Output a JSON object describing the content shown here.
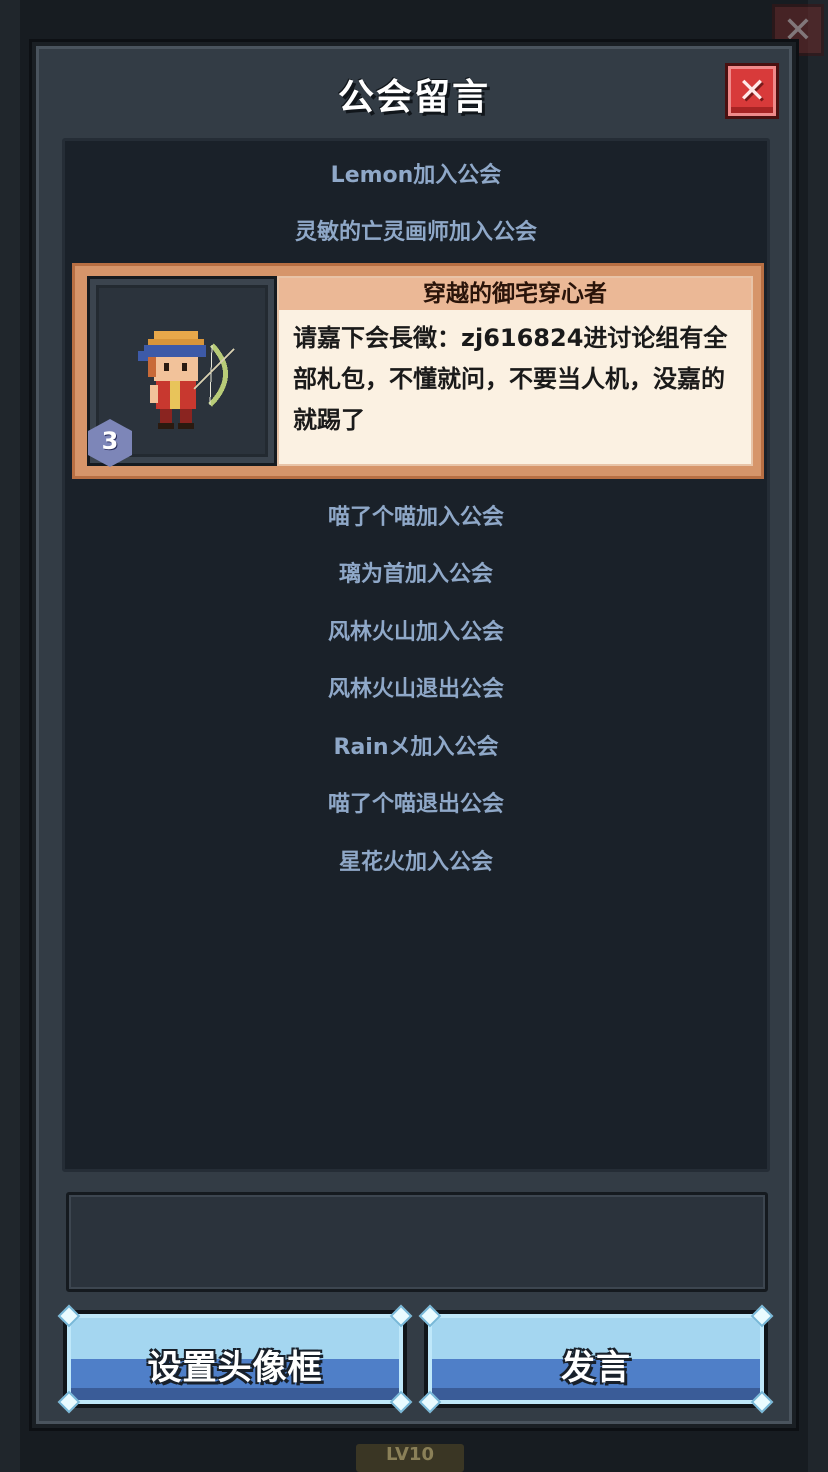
{
  "dialog": {
    "title": "公会留言",
    "close_label": "✕"
  },
  "messages": {
    "system_top": [
      "Lemon加入公会",
      "灵敏的亡灵画师加入公会"
    ],
    "chat": {
      "name": "穿越的御宅穿心者",
      "level": "3",
      "text": "请嘉下会長徵：zj616824进讨论组有全部札包，不懂就问，不要当人机，没嘉的就踢了"
    },
    "system_bottom": [
      "喵了个喵加入公会",
      "璃为首加入公会",
      "风林火山加入公会",
      "风林火山退出公会",
      "Rainメ加入公会",
      "喵了个喵退出公会",
      "星花火加入公会"
    ]
  },
  "input": {
    "value": "",
    "placeholder": ""
  },
  "buttons": {
    "avatar_frame": "设置头像框",
    "send": "发言"
  },
  "background": {
    "level_label": "LV10"
  }
}
